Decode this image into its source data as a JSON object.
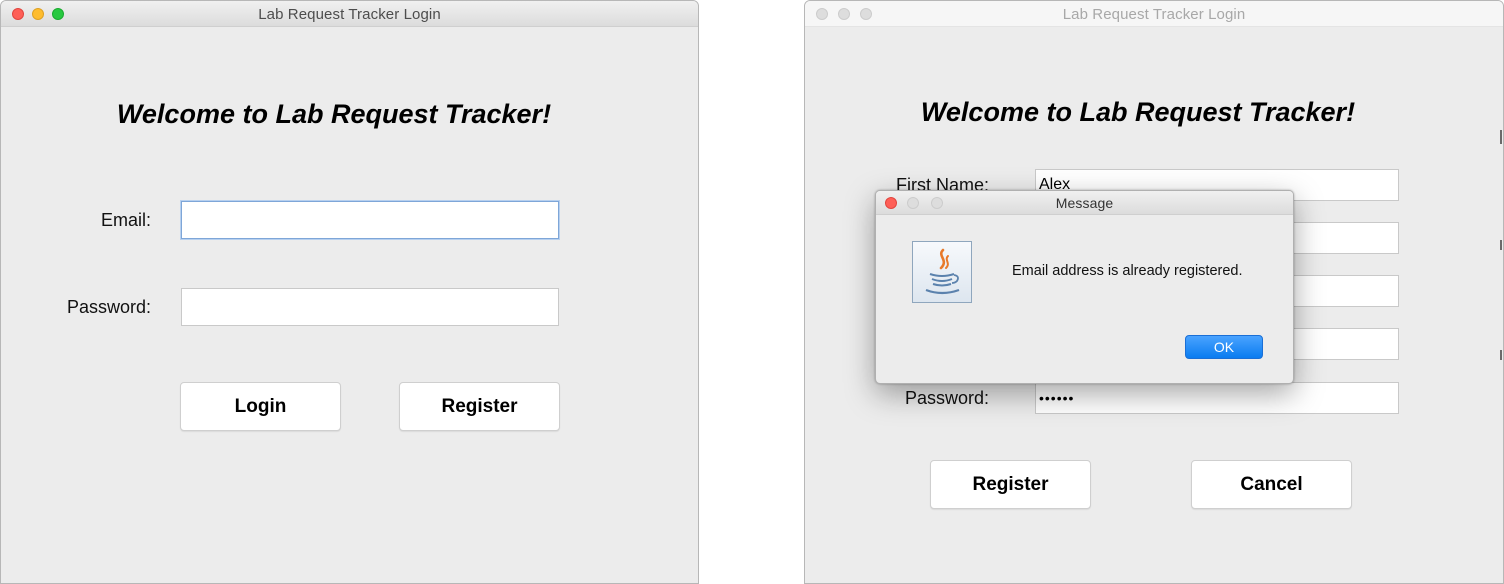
{
  "login_window": {
    "title": "Lab Request Tracker Login",
    "heading": "Welcome to Lab Request Tracker!",
    "email_label": "Email:",
    "email_value": "",
    "password_label": "Password:",
    "password_value": "",
    "login_button": "Login",
    "register_button": "Register"
  },
  "register_window": {
    "title": "Lab Request Tracker Login",
    "heading": "Welcome to Lab Request Tracker!",
    "first_name_label": "First Name:",
    "first_name_value": "Alex",
    "password_label": "Password:",
    "password_value": "••••••",
    "register_button": "Register",
    "cancel_button": "Cancel"
  },
  "message_dialog": {
    "title": "Message",
    "icon": "java-icon",
    "message": "Email address is already registered.",
    "ok_button": "OK"
  },
  "colors": {
    "window_bg": "#ececec",
    "ok_button_blue": "#0a7cf0",
    "close_red": "#fe5f57",
    "minimize_yellow": "#febc2e",
    "zoom_green": "#28c840"
  }
}
